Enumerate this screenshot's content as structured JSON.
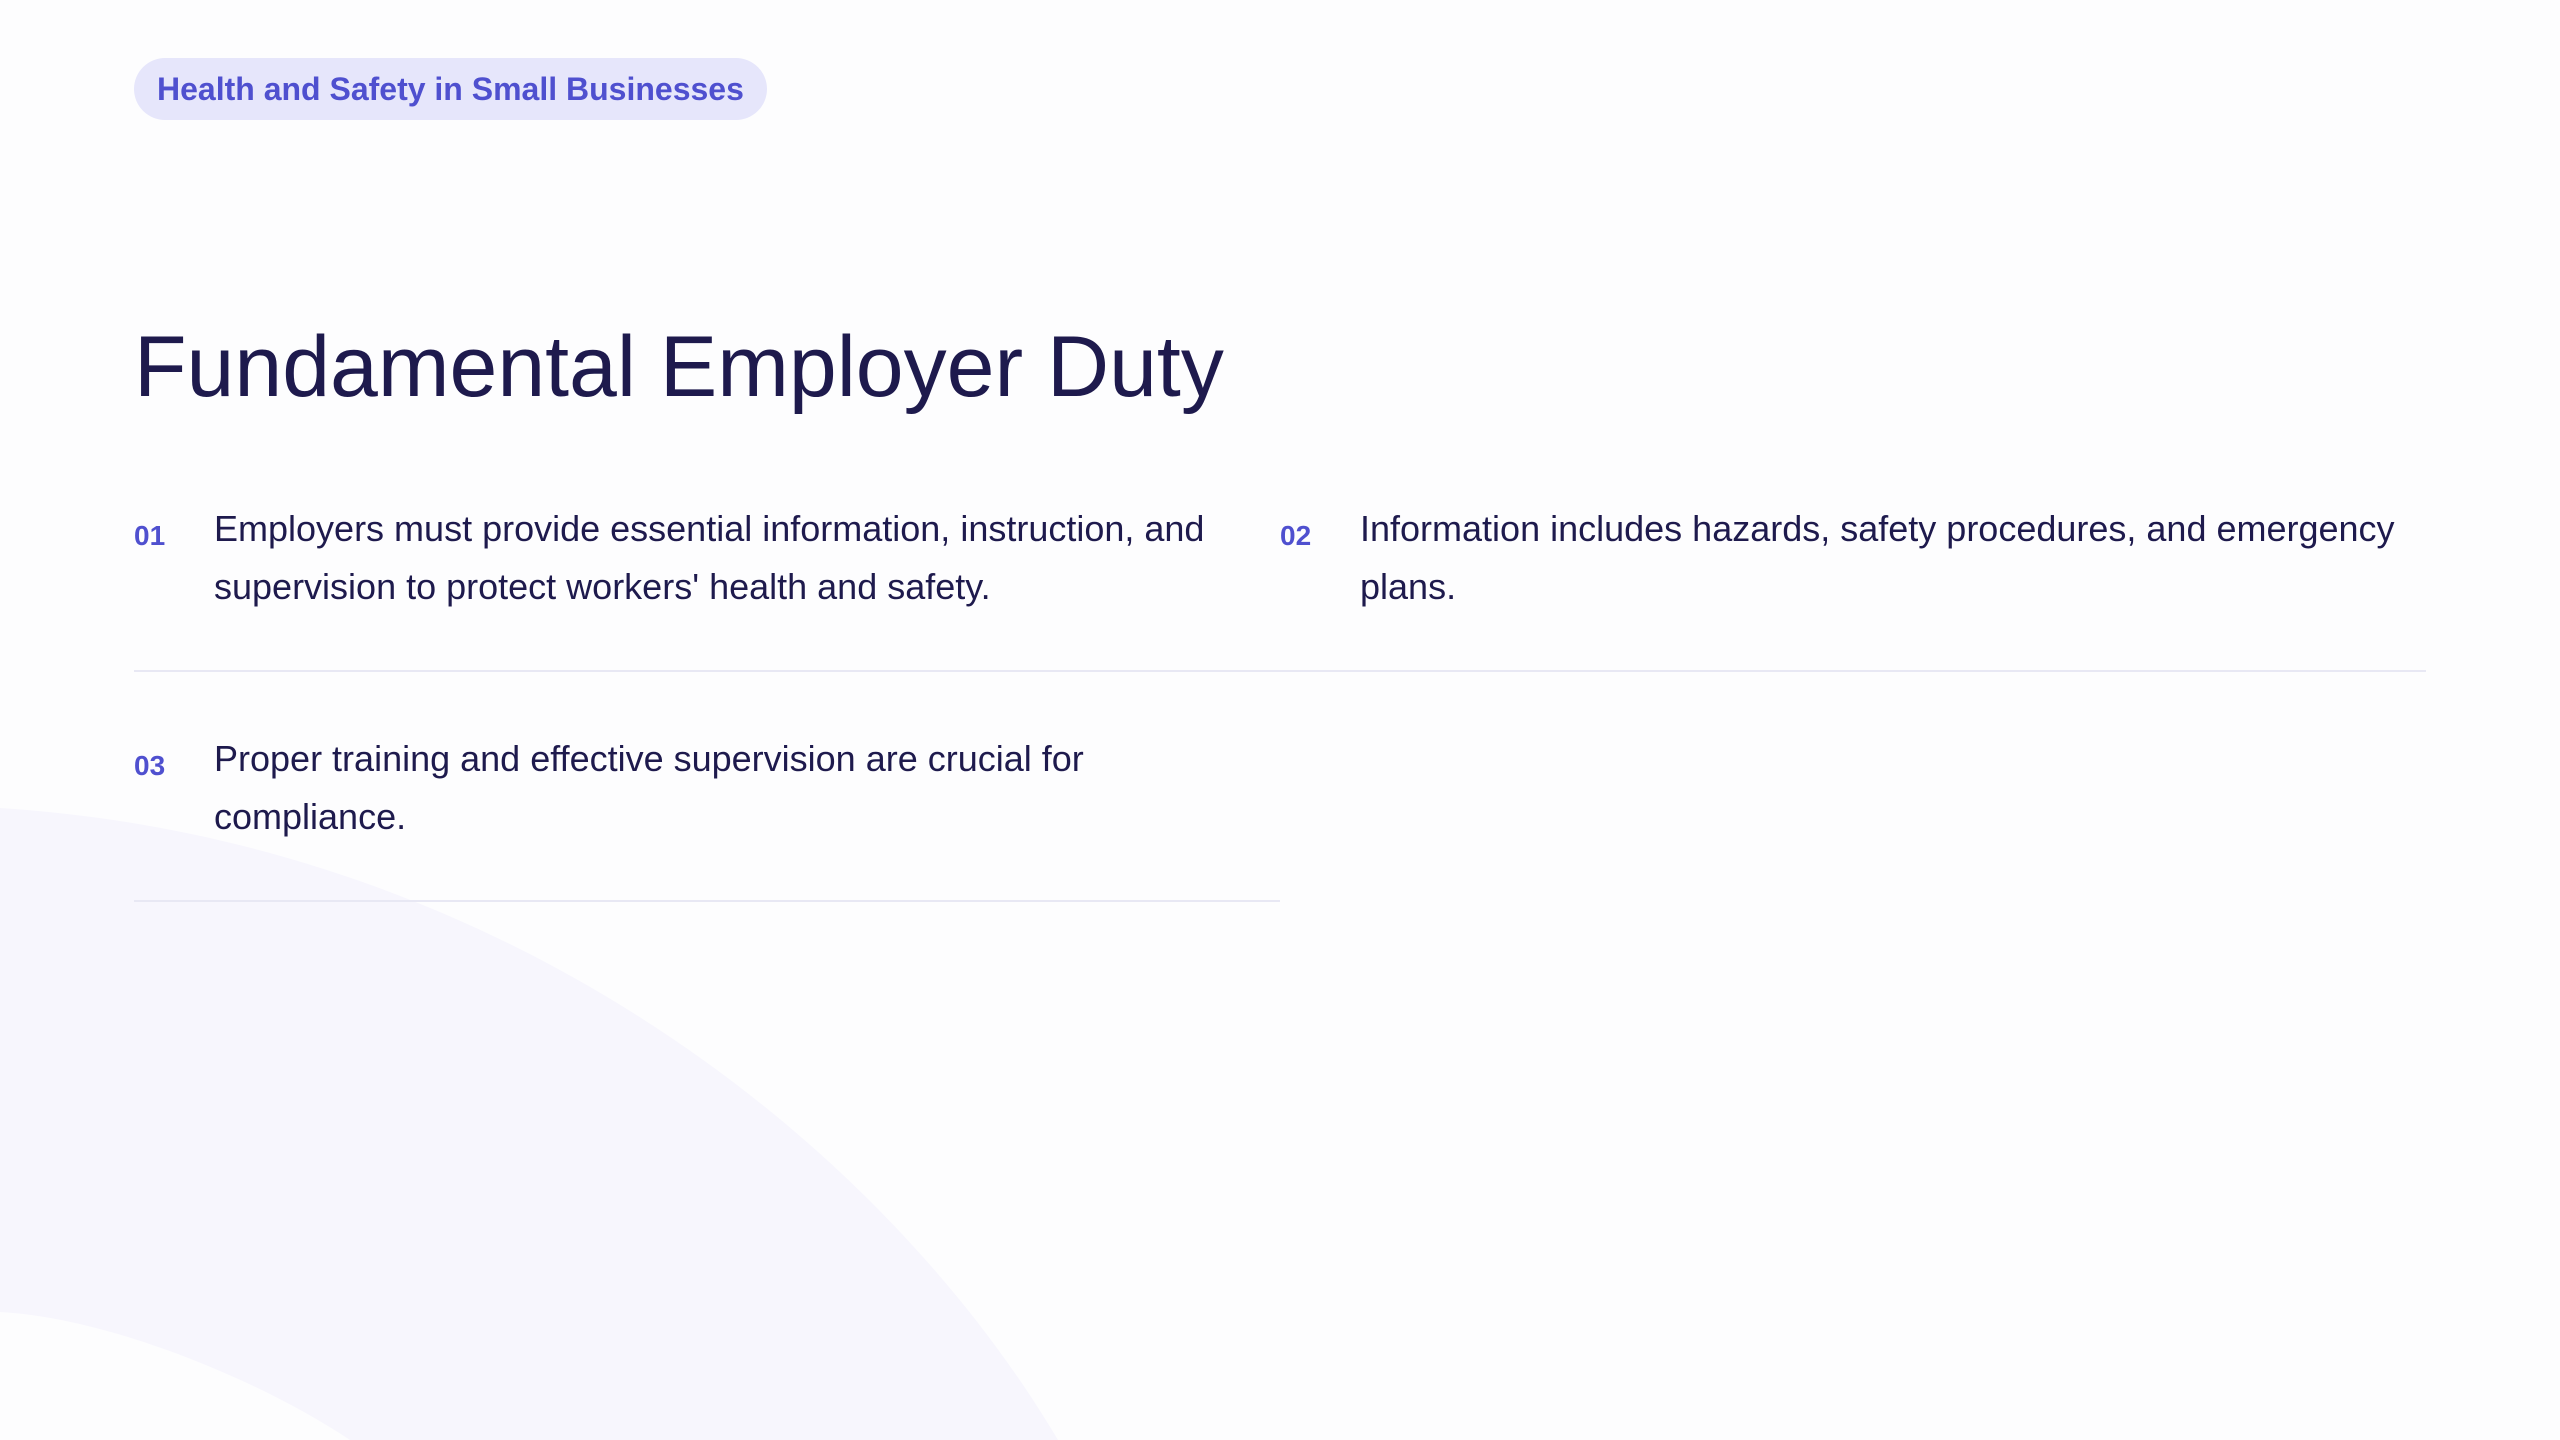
{
  "header": {
    "tag": "Health and Safety in Small Businesses"
  },
  "slide": {
    "title": "Fundamental Employer Duty"
  },
  "points": [
    {
      "number": "01",
      "text": "Employers must provide essential information, instruction, and supervision to protect workers' health and safety."
    },
    {
      "number": "02",
      "text": "Information includes hazards, safety procedures, and emergency plans."
    },
    {
      "number": "03",
      "text": "Proper training and effective supervision are crucial for compliance."
    }
  ],
  "colors": {
    "accent": "#4f50cf",
    "pill_background": "#e6e6fb",
    "title_text": "#1e1a4d",
    "background": "#fdfdfe",
    "decor_arc": "#f7f6fd"
  }
}
